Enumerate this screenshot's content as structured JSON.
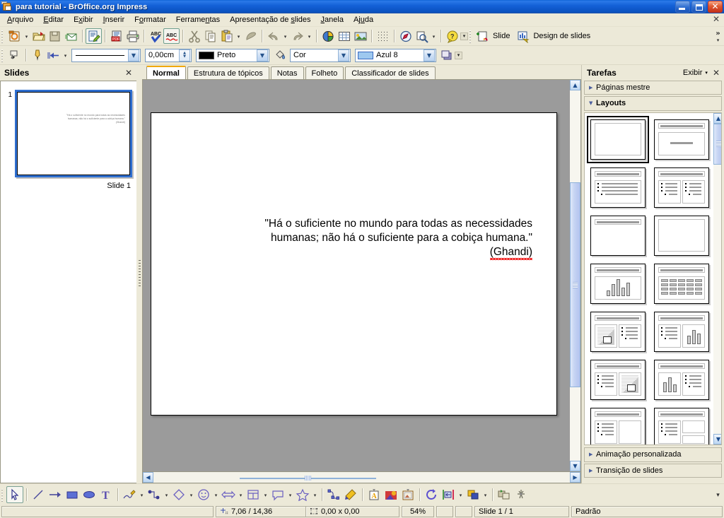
{
  "window": {
    "title": "para tutorial - BrOffice.org Impress",
    "icon": "impress-document-icon",
    "minimize_label": "Minimizar",
    "restore_label": "Restaurar",
    "close_label": "Fechar"
  },
  "menubar": {
    "items": [
      {
        "label": "Arquivo",
        "accel": "A"
      },
      {
        "label": "Editar",
        "accel": "E"
      },
      {
        "label": "Exibir",
        "accel": "x"
      },
      {
        "label": "Inserir",
        "accel": "I"
      },
      {
        "label": "Formatar",
        "accel": "o"
      },
      {
        "label": "Ferramentas",
        "accel": "n"
      },
      {
        "label": "Apresentação de slides",
        "accel": "s"
      },
      {
        "label": "Janela",
        "accel": "J"
      },
      {
        "label": "Ajuda",
        "accel": "u"
      }
    ],
    "close_document_label": "✕"
  },
  "standard_toolbar": {
    "buttons": [
      {
        "name": "new-document",
        "label": "Novo"
      },
      {
        "name": "new-dropdown",
        "label": "▾"
      },
      {
        "name": "open-document",
        "label": "Abrir"
      },
      {
        "name": "save-document",
        "label": "Salvar"
      },
      {
        "name": "send-email",
        "label": "Documento como e-mail"
      },
      {
        "name": "edit-file",
        "label": "Editar arquivo"
      },
      {
        "name": "export-pdf",
        "label": "Exportar diretamente como PDF"
      },
      {
        "name": "print-file",
        "label": "Imprimir arquivo diretamente"
      },
      {
        "name": "print-preview",
        "label": "Visualizar página"
      },
      {
        "name": "spellcheck",
        "label": "Ortografia e gramática"
      },
      {
        "name": "autospellcheck",
        "label": "Verificação ortográfica automática"
      },
      {
        "name": "cut",
        "label": "Cortar"
      },
      {
        "name": "copy",
        "label": "Copiar"
      },
      {
        "name": "paste",
        "label": "Colar"
      },
      {
        "name": "paste-dropdown",
        "label": "▾"
      },
      {
        "name": "clone-formatting",
        "label": "Pincel de formatação"
      },
      {
        "name": "undo",
        "label": "Desfazer"
      },
      {
        "name": "undo-dropdown",
        "label": "▾"
      },
      {
        "name": "redo",
        "label": "Refazer"
      },
      {
        "name": "redo-dropdown",
        "label": "▾"
      },
      {
        "name": "insert-chart",
        "label": "Gráfico"
      },
      {
        "name": "insert-table",
        "label": "Tabela"
      },
      {
        "name": "insert-image",
        "label": "Figura"
      },
      {
        "name": "display-grid",
        "label": "Exibir grade"
      },
      {
        "name": "navigator",
        "label": "Navegador"
      },
      {
        "name": "zoom",
        "label": "Zoom"
      },
      {
        "name": "zoom-dropdown",
        "label": "▾"
      },
      {
        "name": "help",
        "label": "Ajuda do BrOffice.org"
      }
    ],
    "presentation_group": [
      {
        "name": "new-slide",
        "label": "Slide"
      },
      {
        "name": "slide-design",
        "label": "Design de slides"
      }
    ],
    "overflow_label": "»"
  },
  "line_fill_toolbar": {
    "buttons": [
      {
        "name": "select-tool",
        "label": "Selecionar"
      },
      {
        "name": "line-color-pen",
        "label": "Cor da linha"
      },
      {
        "name": "arrow-style",
        "label": "Estilo de seta"
      },
      {
        "name": "arrow-style-dropdown",
        "label": "▾"
      }
    ],
    "line_style": {
      "value": "—————",
      "name": "line-style-combo"
    },
    "line_width": {
      "value": "0,00cm",
      "name": "line-width-spinner"
    },
    "line_color": {
      "value": "Preto",
      "swatch": "#000000",
      "name": "line-color-combo"
    },
    "area_style": {
      "value": "Cor",
      "name": "area-style-combo"
    },
    "area_fill": {
      "value": "Azul 8",
      "swatch": "#9ec8ef",
      "name": "area-fill-combo"
    },
    "shadow_button": {
      "label": "Sombra",
      "name": "shadow-button"
    }
  },
  "slides_pane": {
    "title": "Slides",
    "close_label": "✕",
    "slides": [
      {
        "number": "1",
        "label": "Slide 1",
        "selected": true,
        "preview_lines": [
          "\"Há o suficiente no mundo para todas as necessidades",
          "humanas; não há o suficiente para a cobiça humana.\"",
          "(Ghandi)"
        ]
      }
    ]
  },
  "view_tabs": [
    {
      "label": "Normal",
      "active": true
    },
    {
      "label": "Estrutura de tópicos",
      "active": false
    },
    {
      "label": "Notas",
      "active": false
    },
    {
      "label": "Folheto",
      "active": false
    },
    {
      "label": "Classificador de slides",
      "active": false
    }
  ],
  "slide_canvas": {
    "text_lines": [
      "\"Há o suficiente no mundo para todas as necessidades",
      "humanas; não há o suficiente para a cobiça humana.\""
    ],
    "attribution": "(Ghandi)",
    "attribution_misspelled": true,
    "background": "#ffffff"
  },
  "tasks_pane": {
    "title": "Tarefas",
    "view_label": "Exibir",
    "view_caret": "▾",
    "close_label": "✕",
    "sections": [
      {
        "label": "Páginas mestre",
        "expanded": false,
        "name": "master-pages"
      },
      {
        "label": "Layouts",
        "expanded": true,
        "name": "layouts"
      },
      {
        "label": "Animação personalizada",
        "expanded": false,
        "name": "custom-animation"
      },
      {
        "label": "Transição de slides",
        "expanded": false,
        "name": "slide-transition"
      }
    ],
    "layouts": [
      {
        "name": "layout-blank",
        "kind": "blank",
        "selected": true
      },
      {
        "name": "layout-title-content",
        "kind": "title-content",
        "selected": false
      },
      {
        "name": "layout-title-bullets",
        "kind": "title-bullets",
        "selected": false
      },
      {
        "name": "layout-title-two-bullets",
        "kind": "title-two-bullets",
        "selected": false
      },
      {
        "name": "layout-title-only",
        "kind": "title-only",
        "selected": false
      },
      {
        "name": "layout-centered-text",
        "kind": "centered-text",
        "selected": false
      },
      {
        "name": "layout-title-chart",
        "kind": "title-chart",
        "selected": false
      },
      {
        "name": "layout-title-table",
        "kind": "title-table",
        "selected": false
      },
      {
        "name": "layout-clipart-bullets",
        "kind": "clipart-bullets",
        "selected": false
      },
      {
        "name": "layout-bullets-chart",
        "kind": "bullets-chart",
        "selected": false
      },
      {
        "name": "layout-bullets-clipart",
        "kind": "bullets-clipart",
        "selected": false
      },
      {
        "name": "layout-chart-bullets",
        "kind": "chart-bullets",
        "selected": false
      },
      {
        "name": "layout-bullets-object",
        "kind": "bullets-object",
        "selected": false
      },
      {
        "name": "layout-bullets-two-objects",
        "kind": "bullets-two-objects",
        "selected": false
      }
    ]
  },
  "drawing_toolbar": {
    "buttons": [
      {
        "name": "selection-tool",
        "label": "Seleção",
        "active": true
      },
      {
        "name": "line-tool",
        "label": "Linha"
      },
      {
        "name": "line-arrow-end-tool",
        "label": "Linha terminando em seta"
      },
      {
        "name": "rectangle-tool",
        "label": "Retângulo"
      },
      {
        "name": "ellipse-tool",
        "label": "Elipse"
      },
      {
        "name": "text-tool",
        "label": "Texto"
      },
      {
        "name": "curve-tool",
        "label": "Curva"
      },
      {
        "name": "curve-dropdown",
        "label": "▾"
      },
      {
        "name": "connector-tool",
        "label": "Conector"
      },
      {
        "name": "connector-dropdown",
        "label": "▾"
      },
      {
        "name": "basic-shapes-tool",
        "label": "Formas simples"
      },
      {
        "name": "basic-shapes-dropdown",
        "label": "▾"
      },
      {
        "name": "symbol-shapes-tool",
        "label": "Formas de símbolos"
      },
      {
        "name": "symbol-shapes-dropdown",
        "label": "▾"
      },
      {
        "name": "block-arrows-tool",
        "label": "Setas cheias"
      },
      {
        "name": "block-arrows-dropdown",
        "label": "▾"
      },
      {
        "name": "flowchart-tool",
        "label": "Fluxogramas"
      },
      {
        "name": "flowchart-dropdown",
        "label": "▾"
      },
      {
        "name": "callout-tool",
        "label": "Textos explicativos"
      },
      {
        "name": "callout-dropdown",
        "label": "▾"
      },
      {
        "name": "stars-tool",
        "label": "Estrelas"
      },
      {
        "name": "stars-dropdown",
        "label": "▾"
      },
      {
        "name": "points-tool",
        "label": "Pontos"
      },
      {
        "name": "glue-points-tool",
        "label": "Pontos de colagem"
      },
      {
        "name": "fontwork-tool",
        "label": "Galeria de Fontwork"
      },
      {
        "name": "from-file-tool",
        "label": "A partir de um arquivo"
      },
      {
        "name": "gallery-tool",
        "label": "Galeria"
      },
      {
        "name": "rotate-tool",
        "label": "Girar"
      },
      {
        "name": "align-tool",
        "label": "Alinhamento"
      },
      {
        "name": "align-dropdown",
        "label": "▾"
      },
      {
        "name": "arrange-tool",
        "label": "Dispor"
      },
      {
        "name": "arrange-dropdown",
        "label": "▾"
      },
      {
        "name": "interaction-tool",
        "label": "Interação"
      },
      {
        "name": "effects-tool",
        "label": "Efeitos"
      }
    ],
    "overflow_label": "▾"
  },
  "status_bar": {
    "style_field": "",
    "cursor_position": "7,06 / 14,36",
    "object_size": "0,00 x 0,00",
    "zoom": "54%",
    "modified_indicator": "",
    "signature_indicator": "",
    "slide_indicator": "Slide 1 / 1",
    "master_page": "Padrão"
  },
  "colors": {
    "titlebar_blue": "#0a52c0",
    "window_face": "#ece9d8",
    "canvas_gray": "#9b9b9b",
    "selection_blue": "#2f6fd0",
    "active_tab_accent": "#f0a800",
    "spellcheck_red": "#ee0000"
  }
}
